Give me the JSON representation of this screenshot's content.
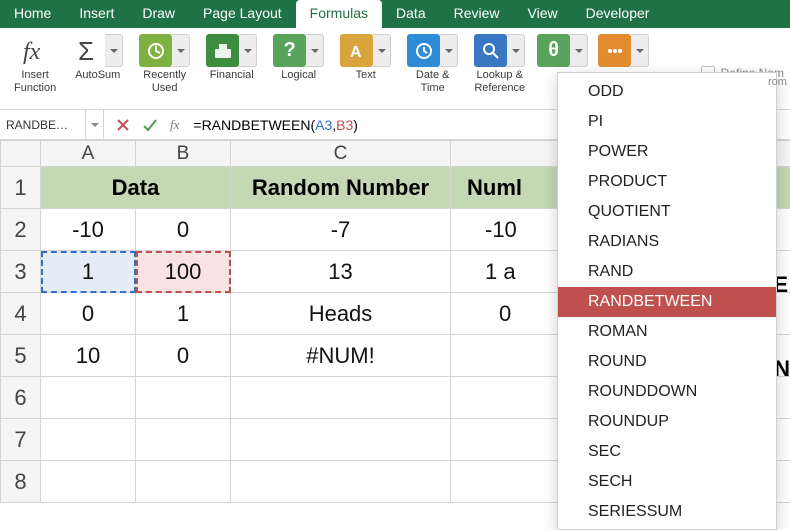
{
  "tabs": {
    "home": "Home",
    "insert": "Insert",
    "draw": "Draw",
    "page_layout": "Page Layout",
    "formulas": "Formulas",
    "data": "Data",
    "review": "Review",
    "view": "View",
    "developer": "Developer"
  },
  "ribbon": {
    "insert_function": "Insert\nFunction",
    "autosum": "AutoSum",
    "recently_used": "Recently\nUsed",
    "financial": "Financial",
    "logical": "Logical",
    "text": "Text",
    "date_time": "Date &\nTime",
    "lookup_reference": "Lookup &\nReference",
    "define_name": "Define Nam",
    "from_suffix": "rom"
  },
  "namebox": "RANDBE…",
  "formula_bar": {
    "prefix": "=RANDBETWEEN(",
    "arg1": "A3",
    "comma": ",",
    "arg2": "B3",
    "suffix": ")"
  },
  "columns": {
    "a": "A",
    "b": "B",
    "c": "C"
  },
  "rows": {
    "r1": "1",
    "r2": "2",
    "r3": "3",
    "r4": "4",
    "r5": "5",
    "r6": "6",
    "r7": "7",
    "r8": "8"
  },
  "headers": {
    "data": "Data",
    "random_number": "Random Number",
    "numl_cut": "Numl"
  },
  "cells": {
    "a2": "-10",
    "b2": "0",
    "c2": "-7",
    "d2": "-10",
    "a3": "1",
    "b3": "100",
    "c3": "13",
    "d3": "1 a",
    "a4": "0",
    "b4": "1",
    "c4": "Heads",
    "d4": "0",
    "a5": "10",
    "b5": "0",
    "c5": "#NUM!"
  },
  "hidden_right": {
    "be": "BE",
    "an": "AN"
  },
  "dropdown": {
    "items": [
      "ODD",
      "PI",
      "POWER",
      "PRODUCT",
      "QUOTIENT",
      "RADIANS",
      "RAND",
      "RANDBETWEEN",
      "ROMAN",
      "ROUND",
      "ROUNDDOWN",
      "ROUNDUP",
      "SEC",
      "SECH",
      "SERIESSUM"
    ],
    "selected": "RANDBETWEEN"
  },
  "colors": {
    "green": "#1f7246",
    "accent_blue": "#2e6fd0",
    "accent_red": "#c0504d",
    "header_fill": "#c3d8b3"
  }
}
